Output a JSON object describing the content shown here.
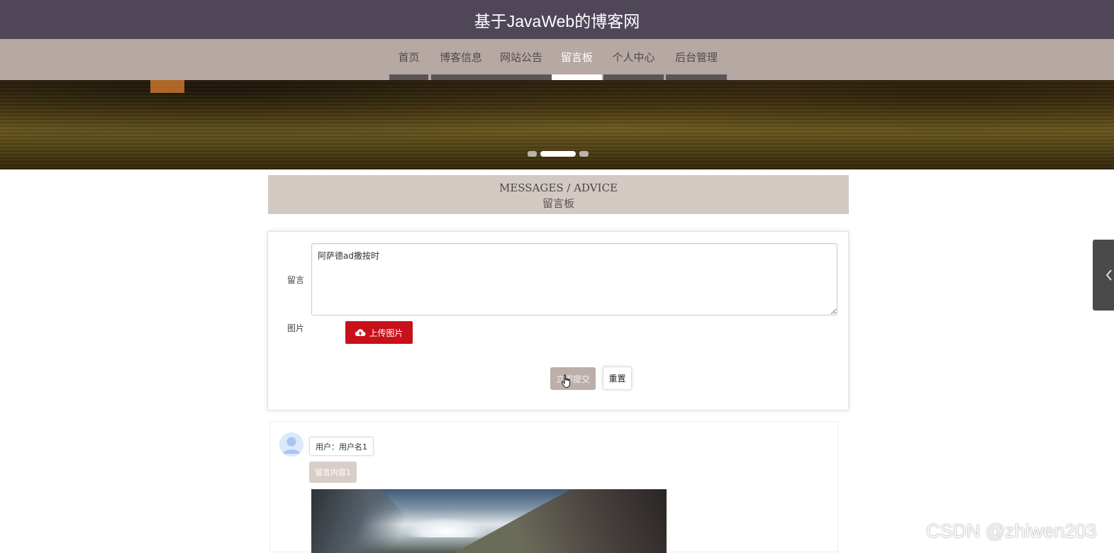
{
  "header": {
    "site_title": "基于JavaWeb的博客网"
  },
  "nav": {
    "items": [
      {
        "label": "首页",
        "active": false
      },
      {
        "label": "博客信息",
        "active": false
      },
      {
        "label": "网站公告",
        "active": false
      },
      {
        "label": "留言板",
        "active": true
      },
      {
        "label": "个人中心",
        "active": false
      },
      {
        "label": "后台管理",
        "active": false
      }
    ]
  },
  "banner": {
    "slide_count": 3,
    "active_slide": 2
  },
  "section": {
    "title_en": "MESSAGES / ADVICE",
    "title_cn": "留言板"
  },
  "form": {
    "message_label": "留言",
    "message_value": "阿萨德ad撒按时",
    "image_label": "图片",
    "upload_label": "上传图片",
    "submit_label": "立即提交",
    "reset_label": "重置"
  },
  "messages": [
    {
      "user": "用户：用户名1",
      "content": "留言内容1"
    }
  ],
  "watermark": "CSDN @zhiwen203",
  "colors": {
    "header_bg": "#4f4758",
    "nav_bg": "#b6a8a2",
    "section_bg": "#d3c9c3",
    "upload_btn": "#c8101a",
    "submit_btn": "#bcaea8"
  }
}
